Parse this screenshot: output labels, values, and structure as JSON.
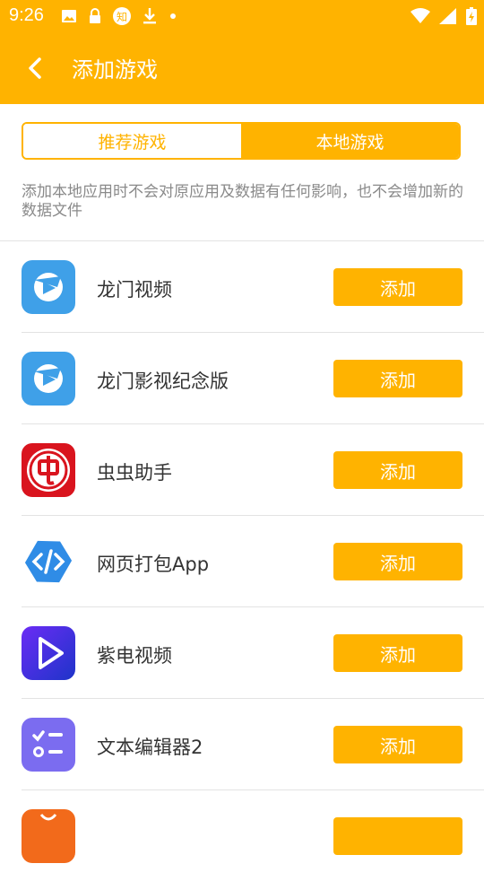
{
  "status_bar": {
    "time": "9:26",
    "left_icons": [
      "image-icon",
      "lock-icon",
      "zhi-icon",
      "download-icon",
      "dot-icon"
    ],
    "zhi_text": "知",
    "right_icons": [
      "wifi-icon",
      "signal-icon",
      "battery-icon"
    ]
  },
  "appbar": {
    "title": "添加游戏",
    "back_icon": "back-arrow-icon"
  },
  "tabs": [
    {
      "label": "推荐游戏",
      "selected": false
    },
    {
      "label": "本地游戏",
      "selected": true
    }
  ],
  "notice": "添加本地应用时不会对原应用及数据有任何影响，也不会增加新的数据文件",
  "apps": [
    {
      "name": "龙门视频",
      "icon": "longmen-icon",
      "action": "添加"
    },
    {
      "name": "龙门影视纪念版",
      "icon": "longmen-memorial-icon",
      "action": "添加"
    },
    {
      "name": "虫虫助手",
      "icon": "chongchong-icon",
      "action": "添加"
    },
    {
      "name": "网页打包App",
      "icon": "code-icon",
      "action": "添加"
    },
    {
      "name": "紫电视频",
      "icon": "play-icon",
      "action": "添加"
    },
    {
      "name": "文本编辑器2",
      "icon": "checklist-icon",
      "action": "添加"
    },
    {
      "name": "",
      "icon": "bag-icon",
      "action": ""
    }
  ],
  "colors": {
    "accent": "#FFB300"
  }
}
